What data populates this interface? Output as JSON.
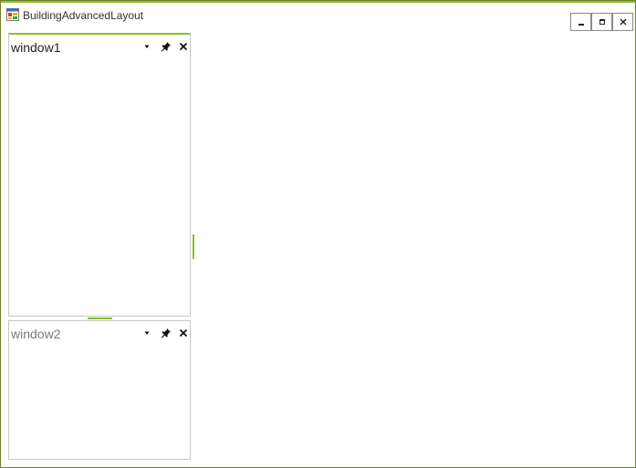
{
  "window": {
    "title": "BuildingAdvancedLayout",
    "icon": "app-icon",
    "accent_color": "#8bbf1f",
    "border_color": "#6f7f2a",
    "controls": [
      {
        "name": "minimize-button",
        "icon": "minimize-icon"
      },
      {
        "name": "maximize-button",
        "icon": "maximize-icon"
      },
      {
        "name": "close-button",
        "icon": "close-icon"
      }
    ]
  },
  "panes": [
    {
      "title": "window1",
      "state": "active"
    },
    {
      "title": "window2",
      "state": "inactive"
    }
  ],
  "pane_tools": [
    {
      "name": "pane-menu-button",
      "icon": "dropdown-arrow-icon"
    },
    {
      "name": "pane-pin-button",
      "icon": "pin-icon"
    },
    {
      "name": "pane-close-button",
      "icon": "close-icon"
    }
  ]
}
